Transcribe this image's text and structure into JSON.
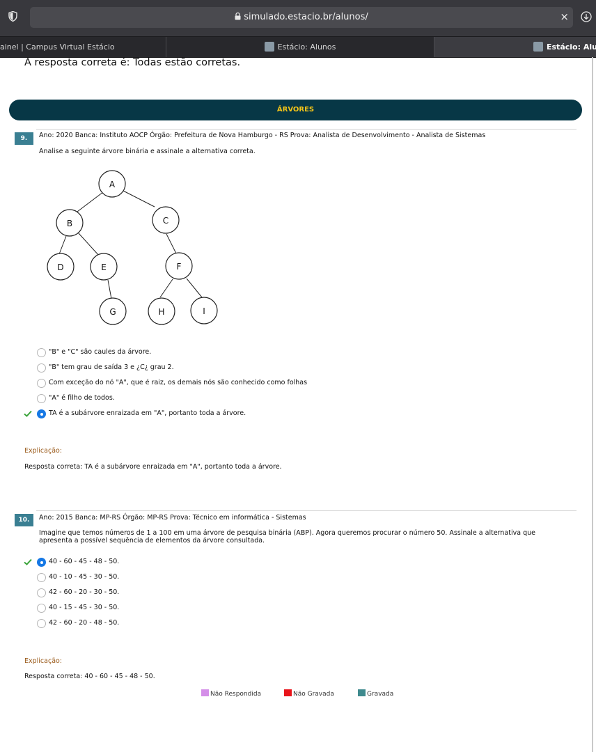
{
  "browser": {
    "url": "simulado.estacio.br/alunos/",
    "close_glyph": "×",
    "tabs": [
      {
        "title": "ainel | Campus Virtual Estácio"
      },
      {
        "title": "Estácio: Alunos"
      },
      {
        "title": "Estácio: Aluno"
      }
    ]
  },
  "top_answer": "A resposta correta é: Todas estão corretas.",
  "section": {
    "title": "ÁRVORES"
  },
  "questions": [
    {
      "number": "9.",
      "header": "Ano: 2020 Banca: Instituto AOCP Órgão: Prefeitura de Nova Hamburgo - RS Prova: Analista de Desenvolvimento - Analista de Sistemas",
      "text": "Analise a seguinte árvore binária e assinale a alternativa correta.",
      "tree_nodes": [
        "A",
        "B",
        "C",
        "D",
        "E",
        "F",
        "G",
        "H",
        "I"
      ],
      "options": [
        {
          "label": "\"B\" e \"C\" são caules da árvore.",
          "selected": false,
          "correct": false
        },
        {
          "label": "\"B\" tem grau de saída 3 e ¿C¿ grau 2.",
          "selected": false,
          "correct": false
        },
        {
          "label": "Com exceção do nó \"A\", que é raiz, os demais nós são conhecido como folhas",
          "selected": false,
          "correct": false
        },
        {
          "label": "\"A\" é filho de todos.",
          "selected": false,
          "correct": false
        },
        {
          "label": "TA é a subárvore enraizada em \"A\", portanto toda a árvore.",
          "selected": true,
          "correct": true
        }
      ],
      "explanation_label": "Explicação:",
      "explanation": "Resposta correta: TA é a subárvore enraizada em \"A\", portanto toda a árvore."
    },
    {
      "number": "10.",
      "header": "Ano: 2015 Banca: MP-RS Órgão: MP-RS Prova: Técnico em informática - Sistemas",
      "text_line1": "Imagine que temos números de 1 a 100 em uma árvore de pesquisa binária (ABP). Agora queremos procurar o número 50. Assinale a alternativa que",
      "text_line2": "apresenta a possível sequência de elementos da árvore consultada.",
      "options": [
        {
          "label": "40 - 60 - 45 - 48 - 50.",
          "selected": true,
          "correct": true
        },
        {
          "label": "40 - 10 - 45 - 30 - 50.",
          "selected": false,
          "correct": false
        },
        {
          "label": "42 - 60 - 20 - 30 - 50.",
          "selected": false,
          "correct": false
        },
        {
          "label": "40 - 15 - 45 - 30 - 50.",
          "selected": false,
          "correct": false
        },
        {
          "label": "42 - 60 - 20 - 48 - 50.",
          "selected": false,
          "correct": false
        }
      ],
      "explanation_label": "Explicação:",
      "explanation": "Resposta correta: 40 - 60 - 45 - 48 - 50."
    }
  ],
  "legend": [
    {
      "label": "Não Respondida",
      "color": "#d48ee8"
    },
    {
      "label": "Não Gravada",
      "color": "#e8141a"
    },
    {
      "label": "Gravada",
      "color": "#3f8a8e"
    }
  ]
}
